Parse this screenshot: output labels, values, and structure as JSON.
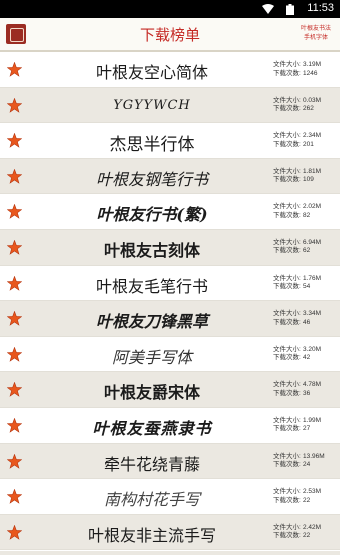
{
  "status_bar": {
    "time": "11:53"
  },
  "header": {
    "title": "下载榜单",
    "corner_line1": "叶根友书法",
    "corner_line2": "手机字体"
  },
  "labels": {
    "size": "文件大小:",
    "downloads": "下载次数:"
  },
  "colors": {
    "accent": "#c52a25",
    "star": "#e8571d",
    "alt_row": "#ebe8e1"
  },
  "fonts": [
    {
      "name": "叶根友空心简体",
      "size": "3.19M",
      "downloads": "1246"
    },
    {
      "name": "YGYYWCH",
      "size": "0.03M",
      "downloads": "262"
    },
    {
      "name": "杰思半行体",
      "size": "2.34M",
      "downloads": "201"
    },
    {
      "name": "叶根友钢笔行书",
      "size": "1.81M",
      "downloads": "109"
    },
    {
      "name": "叶根友行书(繁)",
      "size": "2.02M",
      "downloads": "82"
    },
    {
      "name": "叶根友古刻体",
      "size": "6.94M",
      "downloads": "62"
    },
    {
      "name": "叶根友毛笔行书",
      "size": "1.76M",
      "downloads": "54"
    },
    {
      "name": "叶根友刀锋黑草",
      "size": "3.34M",
      "downloads": "46"
    },
    {
      "name": "阿美手写体",
      "size": "3.20M",
      "downloads": "42"
    },
    {
      "name": "叶根友爵宋体",
      "size": "4.78M",
      "downloads": "36"
    },
    {
      "name": "叶根友蚕燕隶书",
      "size": "1.99M",
      "downloads": "27"
    },
    {
      "name": "牵牛花绕青藤",
      "size": "13.96M",
      "downloads": "24"
    },
    {
      "name": "南构村花手写",
      "size": "2.53M",
      "downloads": "22"
    },
    {
      "name": "叶根友非主流手写",
      "size": "2.42M",
      "downloads": "22"
    }
  ]
}
